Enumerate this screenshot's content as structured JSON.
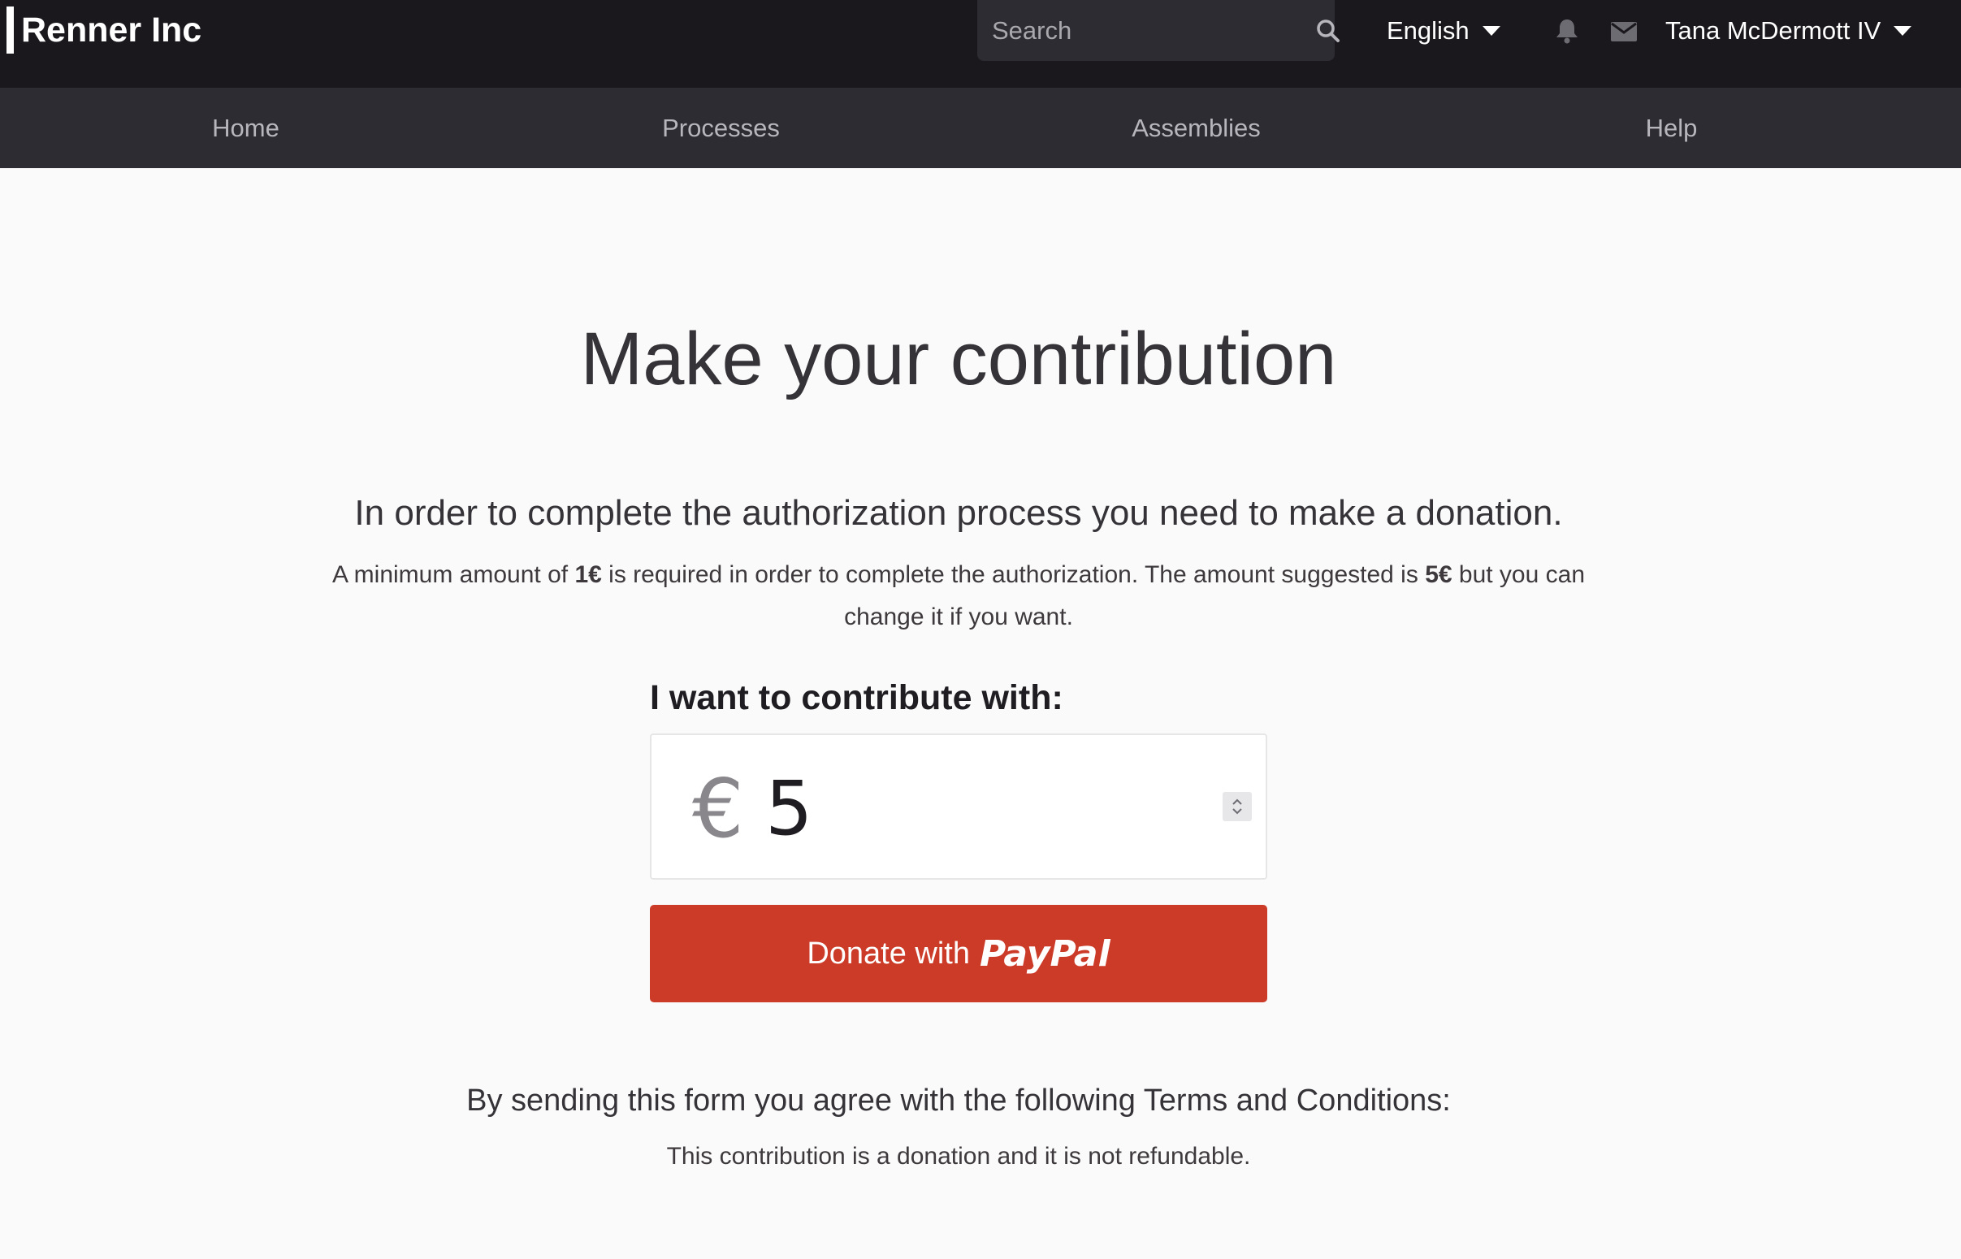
{
  "header": {
    "brand": "Renner Inc",
    "search": {
      "placeholder": "Search",
      "value": ""
    },
    "language": "English",
    "user": "Tana McDermott IV"
  },
  "nav": {
    "items": [
      {
        "label": "Home"
      },
      {
        "label": "Processes"
      },
      {
        "label": "Assemblies"
      },
      {
        "label": "Help"
      }
    ]
  },
  "main": {
    "title": "Make your contribution",
    "lead": "In order to complete the authorization process you need to make a donation.",
    "note": {
      "part1": "A minimum amount of ",
      "min": "1€",
      "part2": " is required in order to complete the authorization. The amount suggested is ",
      "suggested": "5€",
      "part3": " but you can change it if you want."
    },
    "contribute_label": "I want to contribute with:",
    "currency_symbol": "€",
    "amount": "5",
    "donate_button": {
      "prefix": "Donate with",
      "brand": "PayPal"
    },
    "terms_heading": "By sending this form you agree with the following Terms and Conditions:",
    "terms_text": "This contribution is a donation and it is not refundable."
  },
  "colors": {
    "topbar": "#1a181d",
    "navbar": "#2e2c33",
    "donate_button": "#cb3b28",
    "page_background": "#fafafa"
  }
}
